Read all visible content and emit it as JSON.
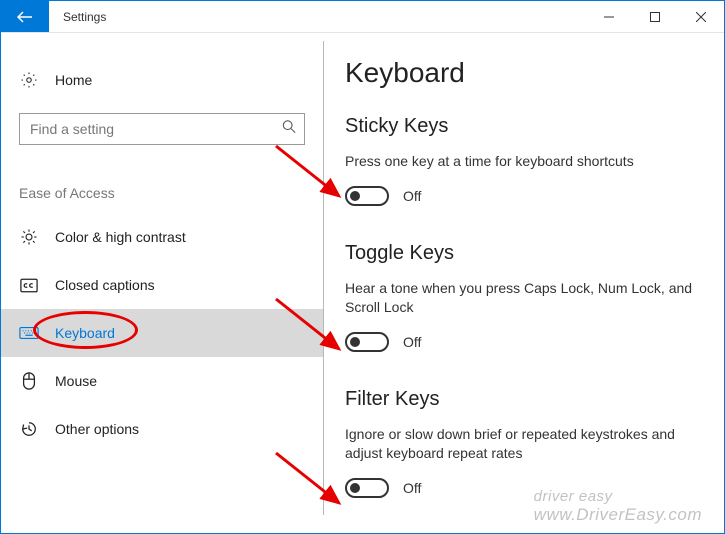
{
  "window": {
    "title": "Settings"
  },
  "sidebar": {
    "home": "Home",
    "search_placeholder": "Find a setting",
    "section": "Ease of Access",
    "items": [
      {
        "label": "Color & high contrast"
      },
      {
        "label": "Closed captions"
      },
      {
        "label": "Keyboard"
      },
      {
        "label": "Mouse"
      },
      {
        "label": "Other options"
      }
    ]
  },
  "main": {
    "title": "Keyboard",
    "sections": [
      {
        "heading": "Sticky Keys",
        "desc": "Press one key at a time for keyboard shortcuts",
        "state": "Off"
      },
      {
        "heading": "Toggle Keys",
        "desc": "Hear a tone when you press Caps Lock, Num Lock, and Scroll Lock",
        "state": "Off"
      },
      {
        "heading": "Filter Keys",
        "desc": "Ignore or slow down brief or repeated keystrokes and adjust keyboard repeat rates",
        "state": "Off"
      }
    ]
  },
  "watermark": {
    "line1": "driver easy",
    "line2": "www.DriverEasy.com"
  }
}
